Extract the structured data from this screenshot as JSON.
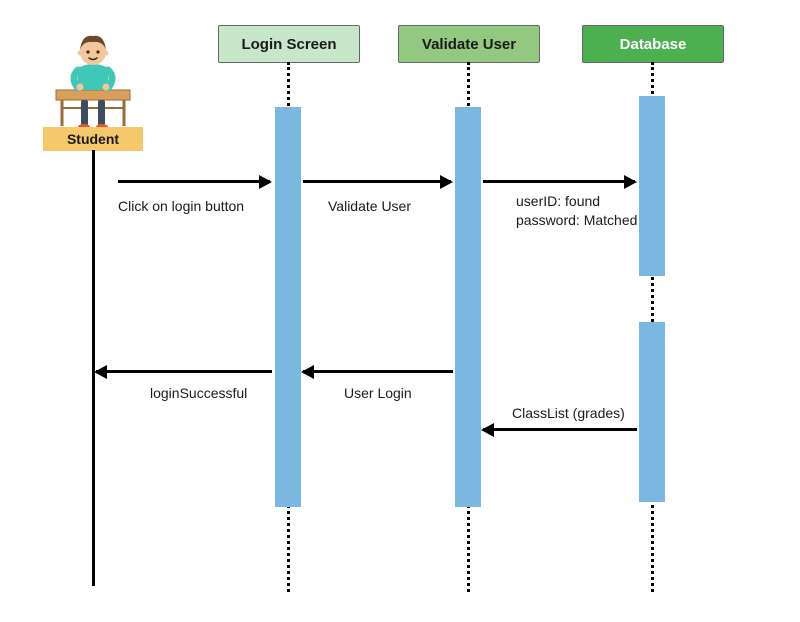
{
  "actors": {
    "student": "Student"
  },
  "participants": {
    "login_screen": "Login Screen",
    "validate_user": "Validate User",
    "database": "Database"
  },
  "messages": {
    "click_login": "Click on login button",
    "validate_user": "Validate User",
    "db_check": "userID: found\npassword: Matched",
    "login_successful": "loginSuccessful",
    "user_login": "User Login",
    "class_list": "ClassList (grades)"
  },
  "colors": {
    "login_screen_bg": "#c8e6c9",
    "validate_user_bg": "#92c87f",
    "database_bg": "#4caf50",
    "activation_bar": "#7ab8e2",
    "student_label_bg": "#f6c86c"
  }
}
